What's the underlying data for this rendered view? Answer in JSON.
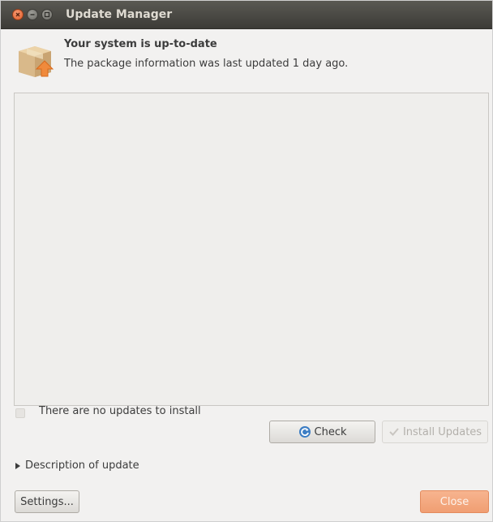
{
  "window": {
    "title": "Update Manager"
  },
  "status": {
    "title": "Your system is up-to-date",
    "subtitle": "The package information was last updated 1 day ago."
  },
  "update_list": {
    "items": [],
    "empty_label": "There are no updates to install"
  },
  "buttons": {
    "check_label": "Check",
    "install_label": "Install Updates",
    "settings_label": "Settings...",
    "close_label": "Close"
  },
  "description": {
    "toggle_label": "Description of update",
    "expanded": false
  },
  "colors": {
    "titlebar": "#3c3b37",
    "accent": "#f09e72",
    "close_button": "#e05a26"
  },
  "icons": {
    "package": "package-update-icon",
    "refresh": "refresh-icon",
    "install": "checkmark-icon"
  }
}
